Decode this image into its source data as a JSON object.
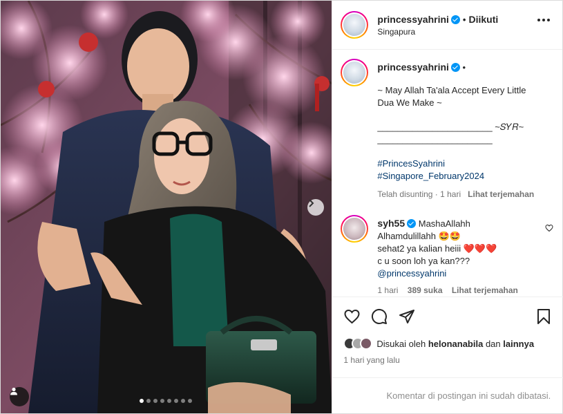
{
  "post": {
    "username": "princessyahrini",
    "follow_status": "Diikuti",
    "location": "Singapura",
    "media": {
      "slide_count": 8,
      "active_slide": 1
    }
  },
  "caption": {
    "username": "princessyahrini",
    "lines": [
      "~ May Allah Ta'ala Accept Every Little",
      "Dua We Make ~"
    ],
    "signature_line1": "_______________________ ~𝑆𝑌𝑅~",
    "signature_line2": "_______________________",
    "hashtags": [
      "#PrincesSyahrini",
      "#Singapore_February2024"
    ],
    "time": "Telah disunting · 1 hari",
    "translate": "Lihat terjemahan"
  },
  "comment": {
    "username": "syh55",
    "line1": "MashaAllahh",
    "line2": "Alhamdulillahh 🤩🤩",
    "line3": "sehat2 ya kalian heiii ❤️❤️❤️",
    "line4": "c u soon loh ya kan???",
    "mention": "@princessyahrini",
    "time": "1 hari",
    "likes": "389 suka",
    "translate": "Lihat terjemahan"
  },
  "likes": {
    "prefix": "Disukai oleh",
    "user": "helonanabila",
    "joiner": "dan",
    "others": "lainnya"
  },
  "date": "1 hari yang lalu",
  "comments_closed": "Komentar di postingan ini sudah dibatasi.",
  "colors": {
    "verified": "#0095f6",
    "link": "#00376b",
    "muted": "#737373",
    "border": "#dbdbdb"
  },
  "icons": [
    "chevron-right-icon",
    "user-tag-icon",
    "more-options-icon",
    "heart-icon",
    "comment-icon",
    "share-icon",
    "bookmark-icon",
    "verified-badge-icon"
  ]
}
